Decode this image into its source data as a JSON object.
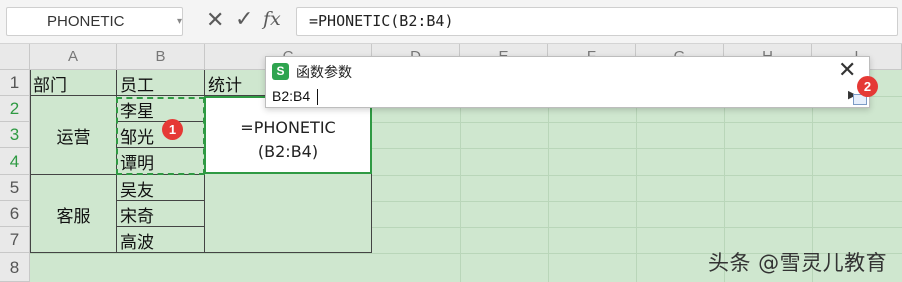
{
  "formula_bar": {
    "name_box": "PHONETIC",
    "cancel_icon": "cancel-icon",
    "confirm_icon": "confirm-icon",
    "fx_label": "fx",
    "formula": "=PHONETIC(B2:B4)"
  },
  "columns": [
    "A",
    "B",
    "C",
    "D",
    "E",
    "F",
    "G",
    "H",
    "I"
  ],
  "rows": [
    "1",
    "2",
    "3",
    "4",
    "5",
    "6",
    "7",
    "8"
  ],
  "cells": {
    "A1": "部门",
    "B1": "员工",
    "C1": "统计",
    "A2": "运营",
    "A5": "客服",
    "B2": "李星",
    "B3": "邹光",
    "B4": "谭明",
    "B5": "吴友",
    "B6": "宋奇",
    "B7": "高波",
    "C2_line1": "=PHONETIC",
    "C2_line2": "(B2:B4)"
  },
  "dialog": {
    "logo": "S",
    "title": "函数参数",
    "input_value": "B2:B4",
    "close_icon": "close-icon"
  },
  "badges": {
    "one": "1",
    "two": "2"
  },
  "watermark": "头条 @雪灵儿教育",
  "colors": {
    "sheet_bg": "#cfe7cf",
    "accent": "#2f9a43",
    "badge": "#e53935"
  }
}
